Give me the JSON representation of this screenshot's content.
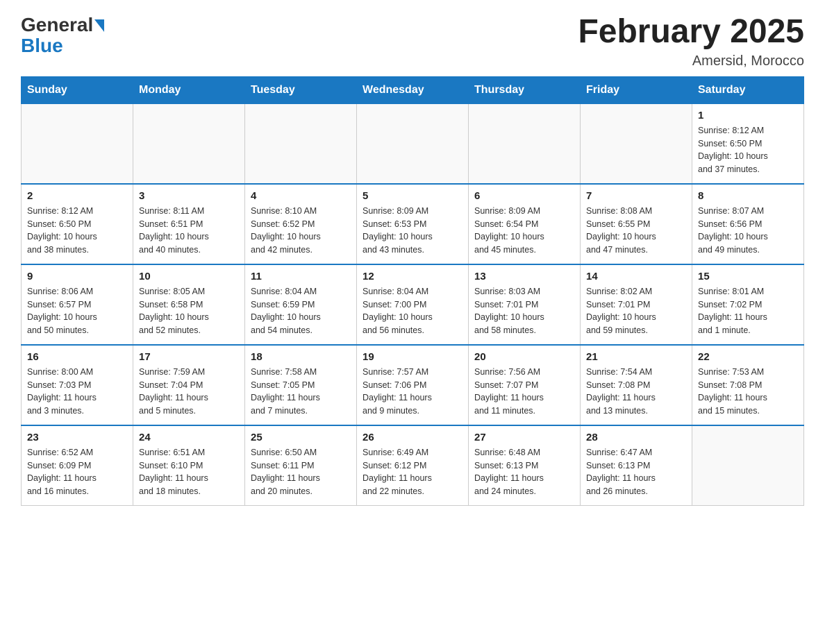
{
  "header": {
    "logo_general": "General",
    "logo_blue": "Blue",
    "month_title": "February 2025",
    "location": "Amersid, Morocco"
  },
  "days_of_week": [
    "Sunday",
    "Monday",
    "Tuesday",
    "Wednesday",
    "Thursday",
    "Friday",
    "Saturday"
  ],
  "weeks": [
    [
      {
        "day": "",
        "info": ""
      },
      {
        "day": "",
        "info": ""
      },
      {
        "day": "",
        "info": ""
      },
      {
        "day": "",
        "info": ""
      },
      {
        "day": "",
        "info": ""
      },
      {
        "day": "",
        "info": ""
      },
      {
        "day": "1",
        "info": "Sunrise: 8:12 AM\nSunset: 6:50 PM\nDaylight: 10 hours\nand 37 minutes."
      }
    ],
    [
      {
        "day": "2",
        "info": "Sunrise: 8:12 AM\nSunset: 6:50 PM\nDaylight: 10 hours\nand 38 minutes."
      },
      {
        "day": "3",
        "info": "Sunrise: 8:11 AM\nSunset: 6:51 PM\nDaylight: 10 hours\nand 40 minutes."
      },
      {
        "day": "4",
        "info": "Sunrise: 8:10 AM\nSunset: 6:52 PM\nDaylight: 10 hours\nand 42 minutes."
      },
      {
        "day": "5",
        "info": "Sunrise: 8:09 AM\nSunset: 6:53 PM\nDaylight: 10 hours\nand 43 minutes."
      },
      {
        "day": "6",
        "info": "Sunrise: 8:09 AM\nSunset: 6:54 PM\nDaylight: 10 hours\nand 45 minutes."
      },
      {
        "day": "7",
        "info": "Sunrise: 8:08 AM\nSunset: 6:55 PM\nDaylight: 10 hours\nand 47 minutes."
      },
      {
        "day": "8",
        "info": "Sunrise: 8:07 AM\nSunset: 6:56 PM\nDaylight: 10 hours\nand 49 minutes."
      }
    ],
    [
      {
        "day": "9",
        "info": "Sunrise: 8:06 AM\nSunset: 6:57 PM\nDaylight: 10 hours\nand 50 minutes."
      },
      {
        "day": "10",
        "info": "Sunrise: 8:05 AM\nSunset: 6:58 PM\nDaylight: 10 hours\nand 52 minutes."
      },
      {
        "day": "11",
        "info": "Sunrise: 8:04 AM\nSunset: 6:59 PM\nDaylight: 10 hours\nand 54 minutes."
      },
      {
        "day": "12",
        "info": "Sunrise: 8:04 AM\nSunset: 7:00 PM\nDaylight: 10 hours\nand 56 minutes."
      },
      {
        "day": "13",
        "info": "Sunrise: 8:03 AM\nSunset: 7:01 PM\nDaylight: 10 hours\nand 58 minutes."
      },
      {
        "day": "14",
        "info": "Sunrise: 8:02 AM\nSunset: 7:01 PM\nDaylight: 10 hours\nand 59 minutes."
      },
      {
        "day": "15",
        "info": "Sunrise: 8:01 AM\nSunset: 7:02 PM\nDaylight: 11 hours\nand 1 minute."
      }
    ],
    [
      {
        "day": "16",
        "info": "Sunrise: 8:00 AM\nSunset: 7:03 PM\nDaylight: 11 hours\nand 3 minutes."
      },
      {
        "day": "17",
        "info": "Sunrise: 7:59 AM\nSunset: 7:04 PM\nDaylight: 11 hours\nand 5 minutes."
      },
      {
        "day": "18",
        "info": "Sunrise: 7:58 AM\nSunset: 7:05 PM\nDaylight: 11 hours\nand 7 minutes."
      },
      {
        "day": "19",
        "info": "Sunrise: 7:57 AM\nSunset: 7:06 PM\nDaylight: 11 hours\nand 9 minutes."
      },
      {
        "day": "20",
        "info": "Sunrise: 7:56 AM\nSunset: 7:07 PM\nDaylight: 11 hours\nand 11 minutes."
      },
      {
        "day": "21",
        "info": "Sunrise: 7:54 AM\nSunset: 7:08 PM\nDaylight: 11 hours\nand 13 minutes."
      },
      {
        "day": "22",
        "info": "Sunrise: 7:53 AM\nSunset: 7:08 PM\nDaylight: 11 hours\nand 15 minutes."
      }
    ],
    [
      {
        "day": "23",
        "info": "Sunrise: 6:52 AM\nSunset: 6:09 PM\nDaylight: 11 hours\nand 16 minutes."
      },
      {
        "day": "24",
        "info": "Sunrise: 6:51 AM\nSunset: 6:10 PM\nDaylight: 11 hours\nand 18 minutes."
      },
      {
        "day": "25",
        "info": "Sunrise: 6:50 AM\nSunset: 6:11 PM\nDaylight: 11 hours\nand 20 minutes."
      },
      {
        "day": "26",
        "info": "Sunrise: 6:49 AM\nSunset: 6:12 PM\nDaylight: 11 hours\nand 22 minutes."
      },
      {
        "day": "27",
        "info": "Sunrise: 6:48 AM\nSunset: 6:13 PM\nDaylight: 11 hours\nand 24 minutes."
      },
      {
        "day": "28",
        "info": "Sunrise: 6:47 AM\nSunset: 6:13 PM\nDaylight: 11 hours\nand 26 minutes."
      },
      {
        "day": "",
        "info": ""
      }
    ]
  ]
}
